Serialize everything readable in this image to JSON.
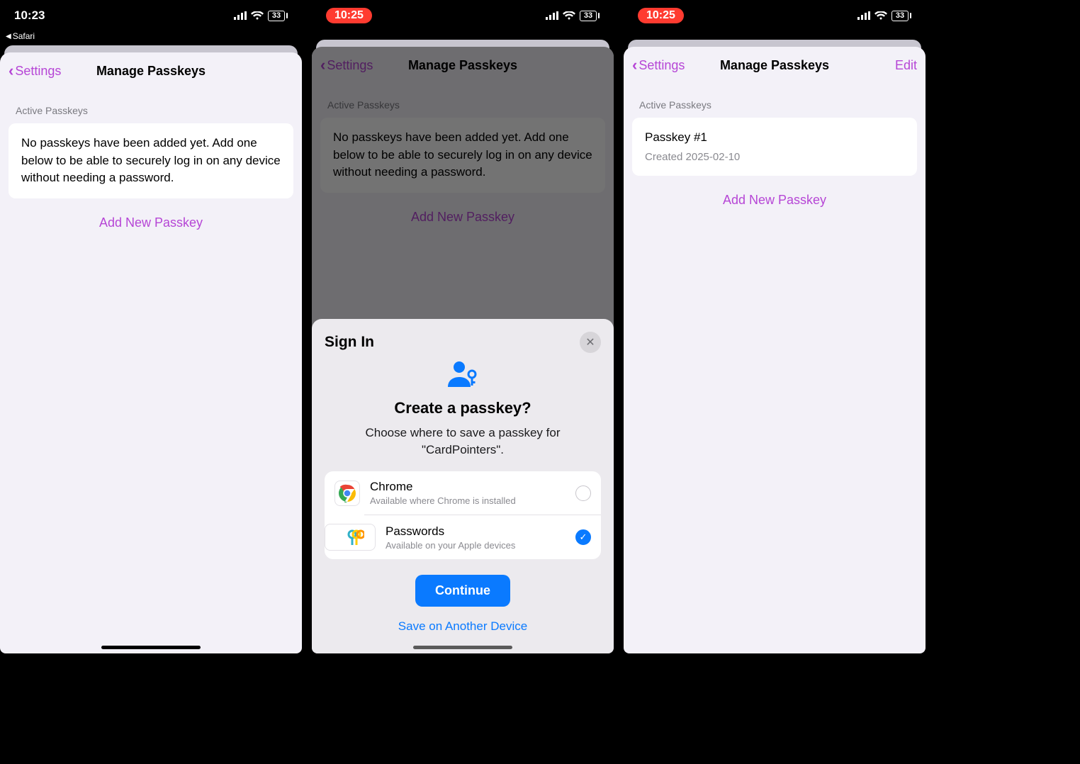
{
  "screens": [
    {
      "status": {
        "time": "10:23",
        "time_pill": false,
        "battery": "33",
        "breadcrumb": "Safari"
      },
      "nav": {
        "back": "Settings",
        "title": "Manage Passkeys",
        "right": ""
      },
      "section_header": "Active Passkeys",
      "empty_text": "No passkeys have been added yet. Add one below to be able to securely log in on any device without needing a password.",
      "add_link": "Add New Passkey"
    },
    {
      "status": {
        "time": "10:25",
        "time_pill": true,
        "battery": "33",
        "breadcrumb": ""
      },
      "nav": {
        "back": "Settings",
        "title": "Manage Passkeys",
        "right": ""
      },
      "section_header": "Active Passkeys",
      "empty_text": "No passkeys have been added yet. Add one below to be able to securely log in on any device without needing a password.",
      "add_link": "Add New Passkey",
      "sheet": {
        "header": "Sign In",
        "title": "Create a passkey?",
        "subtitle": "Choose where to save a passkey for \"CardPointers\".",
        "options": [
          {
            "name": "Chrome",
            "desc": "Available where Chrome is installed",
            "selected": false
          },
          {
            "name": "Passwords",
            "desc": "Available on your Apple devices",
            "selected": true
          }
        ],
        "continue": "Continue",
        "save_other": "Save on Another Device"
      }
    },
    {
      "status": {
        "time": "10:25",
        "time_pill": true,
        "battery": "33",
        "breadcrumb": ""
      },
      "nav": {
        "back": "Settings",
        "title": "Manage Passkeys",
        "right": "Edit"
      },
      "section_header": "Active Passkeys",
      "passkey": {
        "name": "Passkey #1",
        "created": "Created 2025-02-10"
      },
      "add_link": "Add New Passkey"
    }
  ]
}
